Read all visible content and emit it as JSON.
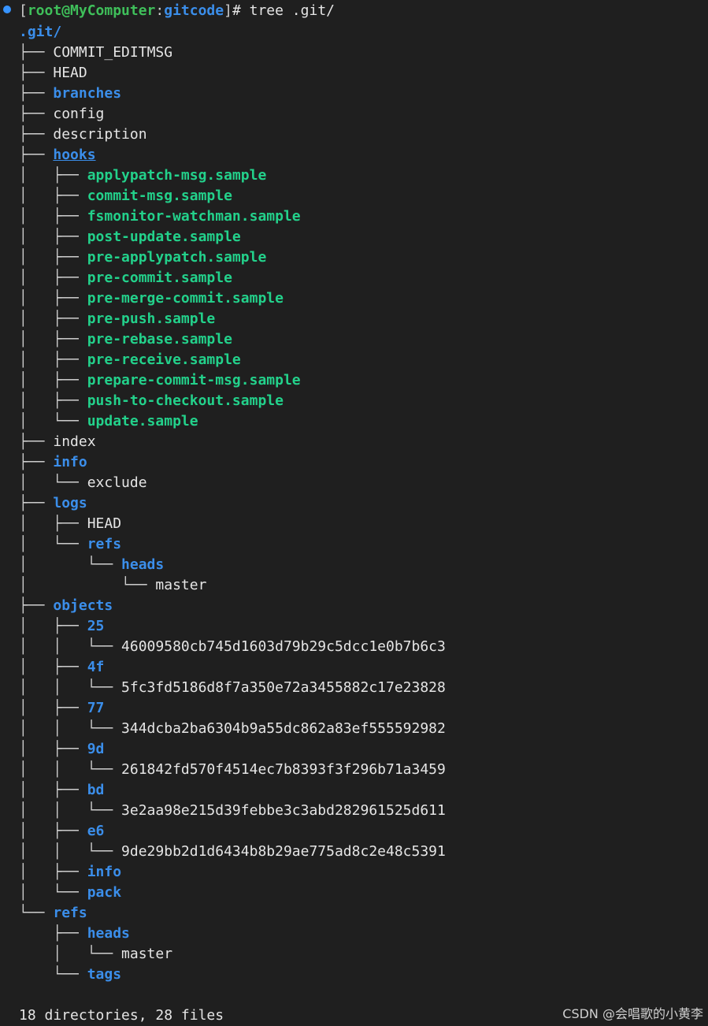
{
  "prompt": {
    "bracket_open": "[",
    "user": "root@MyComputer",
    "colon": ":",
    "dir": "gitcode",
    "bracket_close": "]",
    "command": "# tree .git/"
  },
  "tree": {
    "root": ".git/",
    "items": [
      {
        "prefix": "├── ",
        "name": "COMMIT_EDITMSG"
      },
      {
        "prefix": "├── ",
        "name": "HEAD"
      },
      {
        "prefix": "├── ",
        "name": "branches"
      },
      {
        "prefix": "├── ",
        "name": "config"
      },
      {
        "prefix": "├── ",
        "name": "description"
      },
      {
        "prefix": "├── ",
        "name": "hooks"
      },
      {
        "prefix": "│   ├── ",
        "name": "applypatch-msg.sample"
      },
      {
        "prefix": "│   ├── ",
        "name": "commit-msg.sample"
      },
      {
        "prefix": "│   ├── ",
        "name": "fsmonitor-watchman.sample"
      },
      {
        "prefix": "│   ├── ",
        "name": "post-update.sample"
      },
      {
        "prefix": "│   ├── ",
        "name": "pre-applypatch.sample"
      },
      {
        "prefix": "│   ├── ",
        "name": "pre-commit.sample"
      },
      {
        "prefix": "│   ├── ",
        "name": "pre-merge-commit.sample"
      },
      {
        "prefix": "│   ├── ",
        "name": "pre-push.sample"
      },
      {
        "prefix": "│   ├── ",
        "name": "pre-rebase.sample"
      },
      {
        "prefix": "│   ├── ",
        "name": "pre-receive.sample"
      },
      {
        "prefix": "│   ├── ",
        "name": "prepare-commit-msg.sample"
      },
      {
        "prefix": "│   ├── ",
        "name": "push-to-checkout.sample"
      },
      {
        "prefix": "│   └── ",
        "name": "update.sample"
      },
      {
        "prefix": "├── ",
        "name": "index"
      },
      {
        "prefix": "├── ",
        "name": "info"
      },
      {
        "prefix": "│   └── ",
        "name": "exclude"
      },
      {
        "prefix": "├── ",
        "name": "logs"
      },
      {
        "prefix": "│   ├── ",
        "name": "HEAD"
      },
      {
        "prefix": "│   └── ",
        "name": "refs"
      },
      {
        "prefix": "│       └── ",
        "name": "heads"
      },
      {
        "prefix": "│           └── ",
        "name": "master"
      },
      {
        "prefix": "├── ",
        "name": "objects"
      },
      {
        "prefix": "│   ├── ",
        "name": "25"
      },
      {
        "prefix": "│   │   └── ",
        "name": "46009580cb745d1603d79b29c5dcc1e0b7b6c3"
      },
      {
        "prefix": "│   ├── ",
        "name": "4f"
      },
      {
        "prefix": "│   │   └── ",
        "name": "5fc3fd5186d8f7a350e72a3455882c17e23828"
      },
      {
        "prefix": "│   ├── ",
        "name": "77"
      },
      {
        "prefix": "│   │   └── ",
        "name": "344dcba2ba6304b9a55dc862a83ef555592982"
      },
      {
        "prefix": "│   ├── ",
        "name": "9d"
      },
      {
        "prefix": "│   │   └── ",
        "name": "261842fd570f4514ec7b8393f3f296b71a3459"
      },
      {
        "prefix": "│   ├── ",
        "name": "bd"
      },
      {
        "prefix": "│   │   └── ",
        "name": "3e2aa98e215d39febbe3c3abd282961525d611"
      },
      {
        "prefix": "│   ├── ",
        "name": "e6"
      },
      {
        "prefix": "│   │   └── ",
        "name": "9de29bb2d1d6434b8b29ae775ad8c2e48c5391"
      },
      {
        "prefix": "│   ├── ",
        "name": "info"
      },
      {
        "prefix": "│   └── ",
        "name": "pack"
      },
      {
        "prefix": "└── ",
        "name": "refs"
      },
      {
        "prefix": "    ├── ",
        "name": "heads"
      },
      {
        "prefix": "    │   └── ",
        "name": "master"
      },
      {
        "prefix": "    └── ",
        "name": "tags"
      }
    ]
  },
  "summary": "18 directories, 28 files",
  "watermark": "CSDN @会唱歌的小黄李"
}
